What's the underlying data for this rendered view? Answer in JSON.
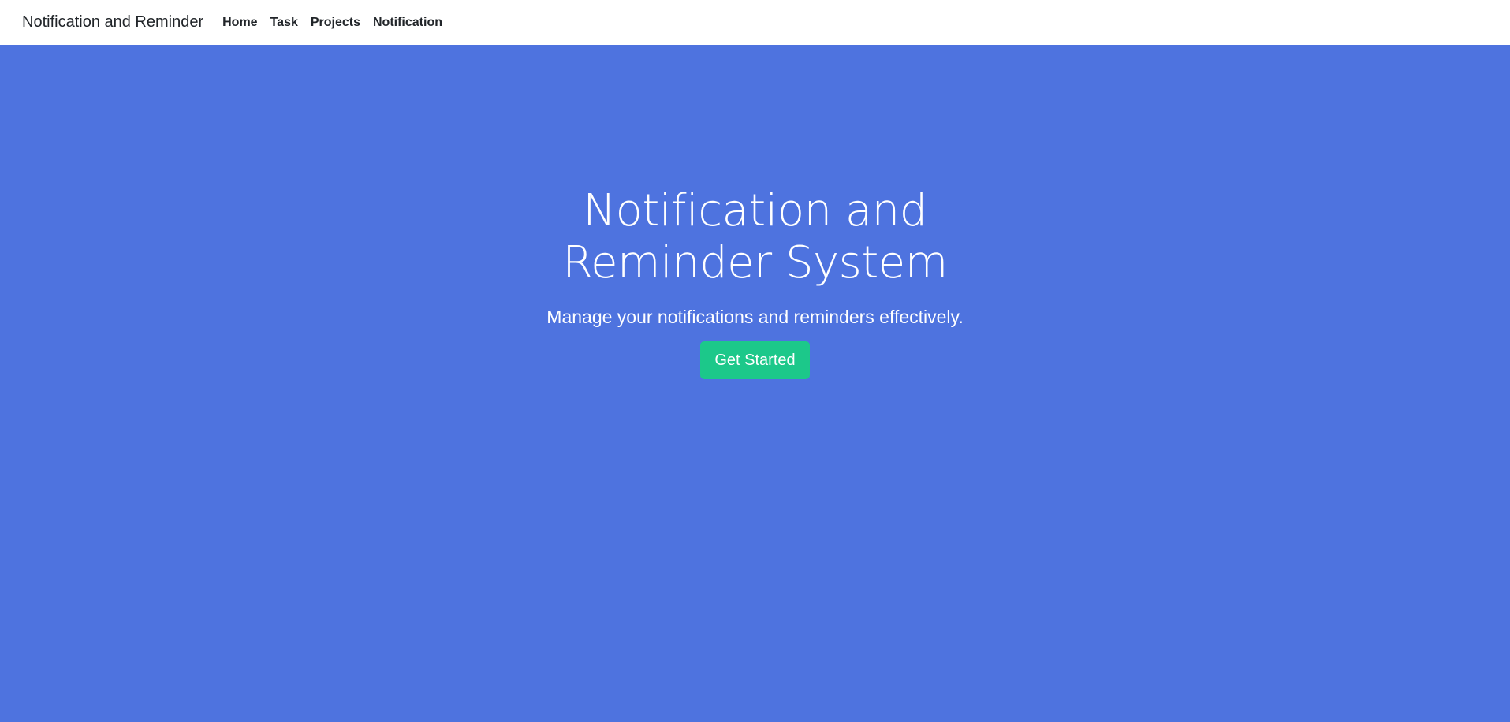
{
  "navbar": {
    "brand": "Notification and Reminder",
    "links": [
      {
        "label": "Home"
      },
      {
        "label": "Task"
      },
      {
        "label": "Projects"
      },
      {
        "label": "Notification"
      }
    ]
  },
  "hero": {
    "title": "Notification and Reminder System",
    "subtitle": "Manage your notifications and reminders effectively.",
    "cta_label": "Get Started"
  },
  "colors": {
    "hero_background": "#4e73df",
    "navbar_background": "#ffffff",
    "cta_background": "#1cc88a",
    "text_dark": "#212529"
  }
}
